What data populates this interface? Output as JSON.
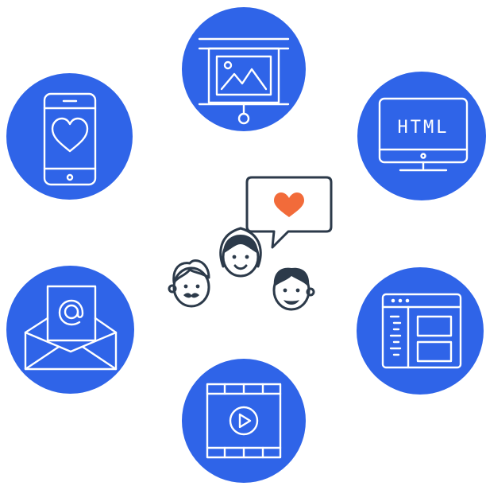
{
  "icons": {
    "presentation": "presentation-icon",
    "phone": "phone-heart-icon",
    "monitor": "html-monitor-icon",
    "email": "email-at-icon",
    "browser": "browser-window-icon",
    "video": "video-play-icon",
    "people": "people-chat-icon"
  },
  "monitor": {
    "label": "HTML"
  },
  "colors": {
    "circle": "#2f64e8",
    "line": "#ffffff",
    "dark": "#2c3a4a",
    "heart": "#f26b3a"
  }
}
